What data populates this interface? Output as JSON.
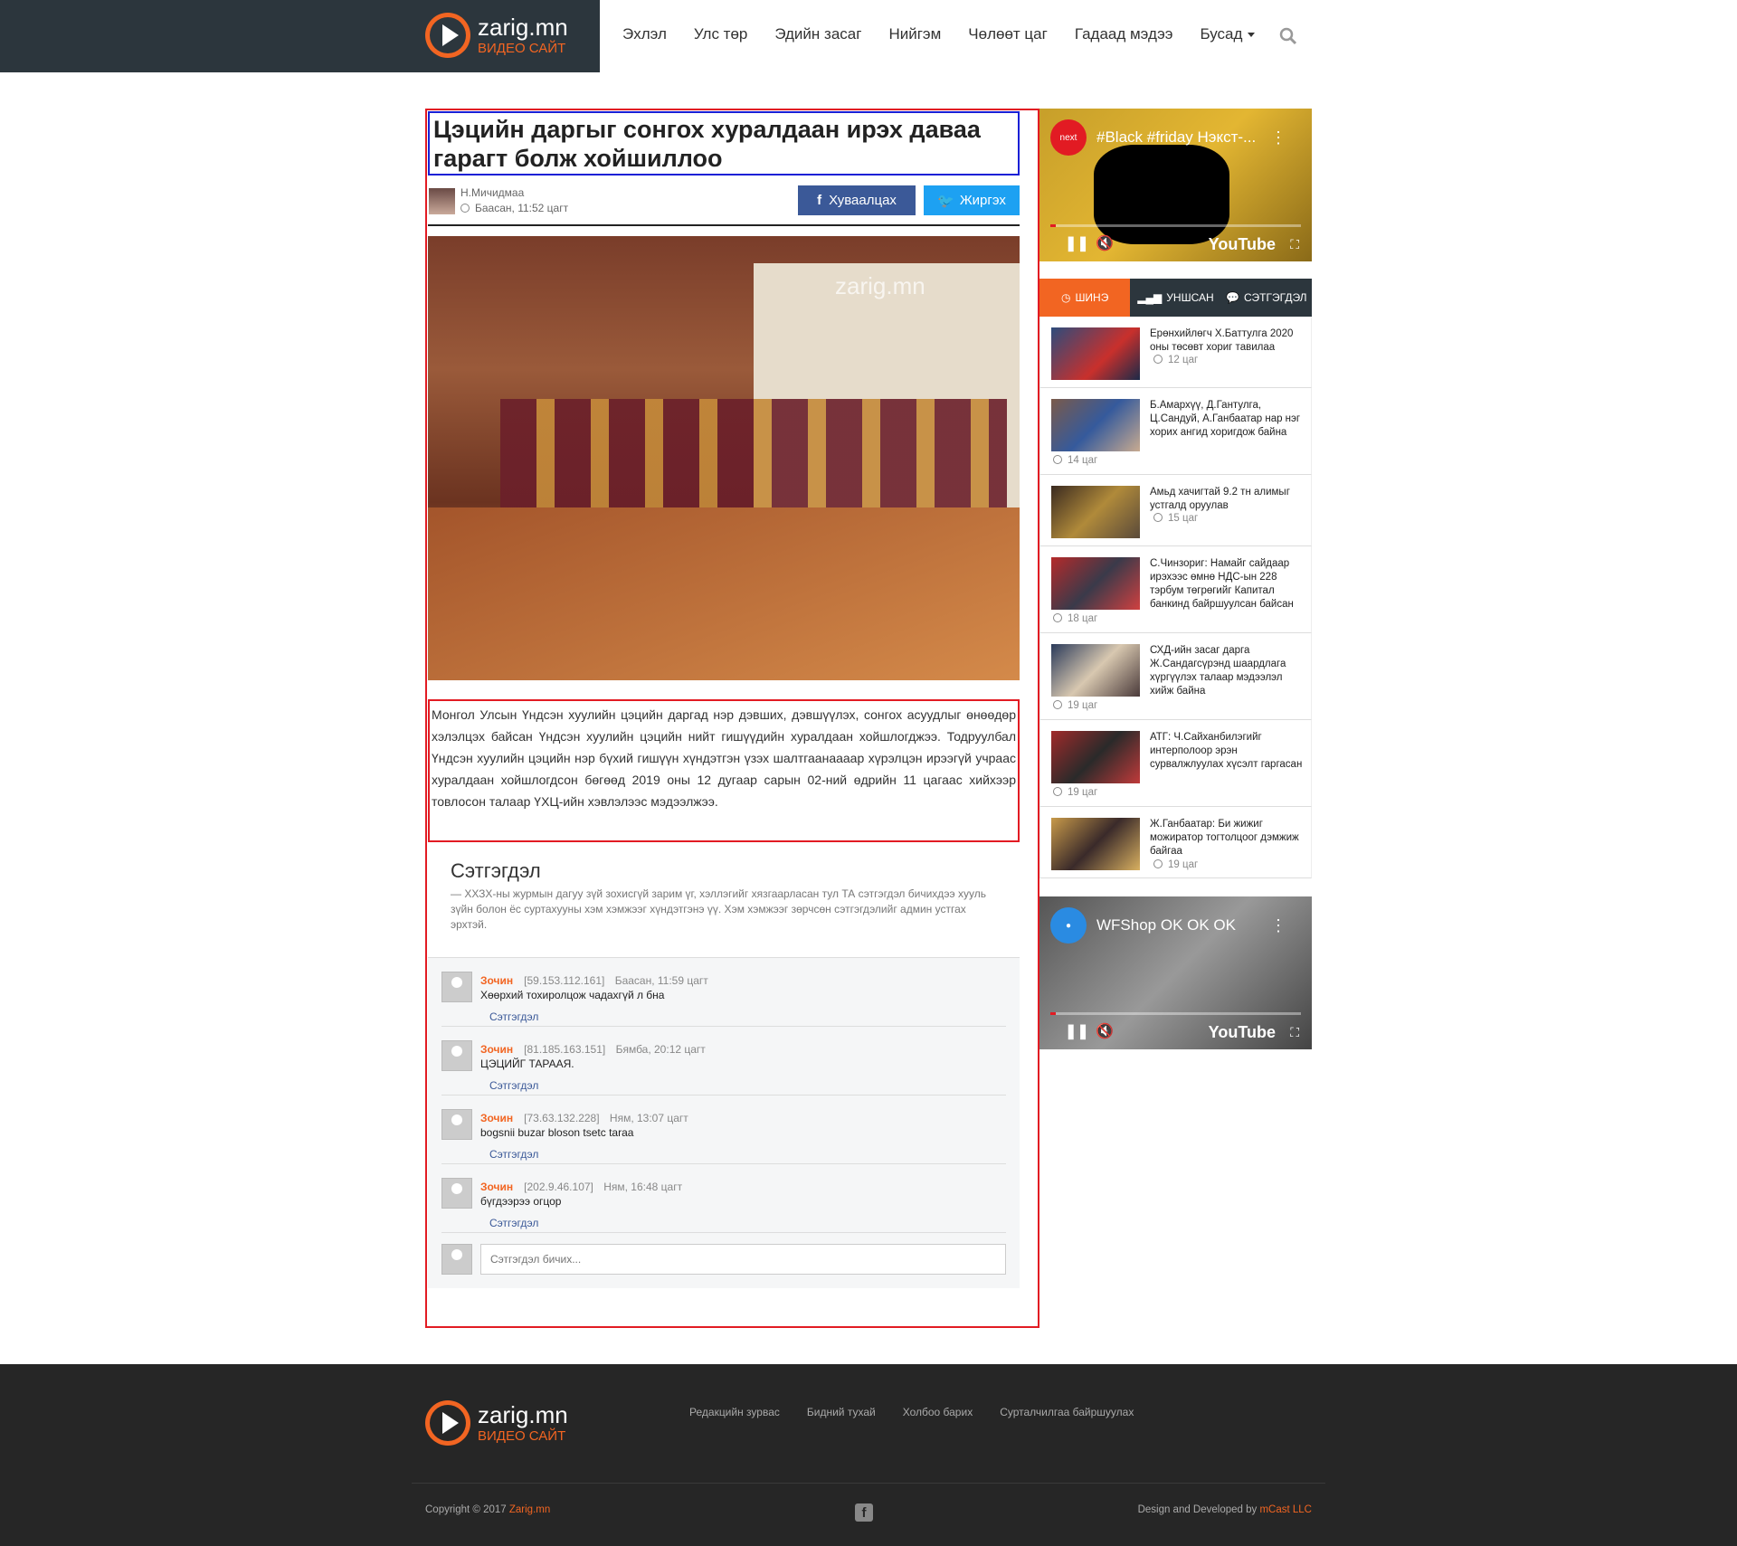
{
  "brand": {
    "name": "zarig.mn",
    "tagline": "ВИДЕО САЙТ",
    "accent": "#f26522",
    "dark": "#2c363d"
  },
  "nav": {
    "items": [
      "Эхлэл",
      "Улс төр",
      "Эдийн засаг",
      "Нийгэм",
      "Чөлөөт цаг",
      "Гадаад мэдээ",
      "Бусад"
    ]
  },
  "article": {
    "title": "Цэцийн даргыг сонгох хуралдаан ирэх даваа гарагт болж хойшиллоо",
    "author": "Н.Мичидмаа",
    "time": "Баасан, 11:52 цагт",
    "share_fb": "Хуваалцах",
    "share_tw": "Жиргэх",
    "image_watermark": "zarig.mn",
    "body": "Монгол Улсын Үндсэн хуулийн цэцийн даргад нэр дэвших, дэвшүүлэх, сонгох асуудлыг өнөөдөр хэлэлцэх байсан Үндсэн хуулийн цэцийн нийт гишүүдийн хуралдаан хойшлогджээ. Тодруулбал Үндсэн хуулийн цэцийн нэр бүхий гишүүн хүндэтгэн үзэх шалтгаанаааар хүрэлцэн ирээгүй учраас хуралдаан хойшлогдсон бөгөөд 2019 оны 12 дугаар сарын 02-ний өдрийн 11 цагаас хийхээр товлосон талаар ҮХЦ-ийн хэвлэлээс мэдээлжээ."
  },
  "comments": {
    "title": "Сэтгэгдэл",
    "note": "— ХХЗХ-ны журмын дагуу зүй зохисгүй зарим үг, хэллэгийг хязгаарласан тул ТА сэтгэгдэл бичихдээ хууль зүйн болон ёс суртахууны хэм хэмжээг хүндэтгэнэ үү. Хэм хэмжээг зөрчсөн сэтгэгдэлийг админ устгах эрхтэй.",
    "reply_label": "Сэтгэгдэл",
    "placeholder": "Сэтгэгдэл бичих...",
    "items": [
      {
        "name": "Зочин",
        "ip": "[59.153.112.161]",
        "time": "Баасан, 11:59 цагт",
        "text": "Хөөрхий тохиролцож чадахгүй л бна"
      },
      {
        "name": "Зочин",
        "ip": "[81.185.163.151]",
        "time": "Бямба, 20:12 цагт",
        "text": "ЦЭЦИЙГ ТАРААЯ."
      },
      {
        "name": "Зочин",
        "ip": "[73.63.132.228]",
        "time": "Ням, 13:07 цагт",
        "text": "bogsnii buzar bloson tsetc taraa"
      },
      {
        "name": "Зочин",
        "ip": "[202.9.46.107]",
        "time": "Ням, 16:48 цагт",
        "text": "бүгдээрээ огцор"
      }
    ]
  },
  "sidebar": {
    "video1": {
      "channel": "next",
      "title": "#Black #friday Нэкст-...",
      "youtube": "YouTube"
    },
    "video2": {
      "title": "WFShop OK OK OK",
      "youtube": "YouTube"
    },
    "tabs": [
      "ШИНЭ",
      "УНШСАН",
      "СЭТГЭГДЭЛ"
    ],
    "news": [
      {
        "title": "Ерөнхийлөгч Х.Баттулга 2020 оны төсөвт хориг тавилаа",
        "time": "12 цаг"
      },
      {
        "title": "Б.Амархүү, Д.Гантулга, Ц.Сандуй, А.Ганбаатар нар нэг хорих ангид хоригдож байна",
        "time": "14 цаг"
      },
      {
        "title": "Амьд хачигтай 9.2 тн алимыг устгалд оруулав",
        "time": "15 цаг"
      },
      {
        "title": "С.Чинзориг: Намайг сайдаар ирэхээс өмнө НДС-ын 228 тэрбум төгрөгийг Капитал банкинд байршуулсан байсан",
        "time": "18 цаг"
      },
      {
        "title": "СХД-ийн засаг дарга Ж.Сандагсүрэнд шаардлага хүргүүлэх талаар мэдээлэл хийж байна",
        "time": "19 цаг"
      },
      {
        "title": "АТГ: Ч.Сайханбилэгийг интерполоор эрэн сурвалжлуулах хүсэлт гаргасан",
        "time": "19 цаг"
      },
      {
        "title": "Ж.Ганбаатар: Би жижиг можиратор тогтолцоог дэмжиж байгаа",
        "time": "19 цаг"
      }
    ]
  },
  "footer": {
    "links": [
      "Редакцийн зурвас",
      "Бидний тухай",
      "Холбоо барих",
      "Сурталчилгаа байршуулах"
    ],
    "copyright_prefix": "Copyright © 2017",
    "copyright_link": "Zarig.mn",
    "dev_prefix": "Design and Developed by",
    "dev_link": "mCast LLC"
  }
}
